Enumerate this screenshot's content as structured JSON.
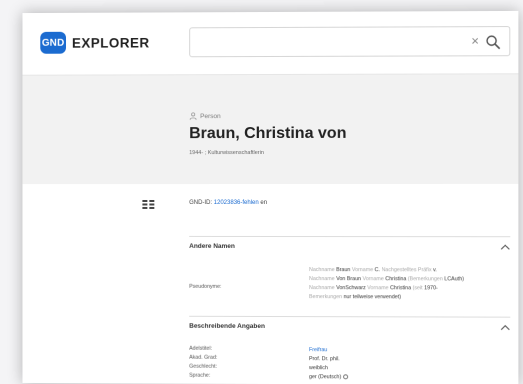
{
  "app": {
    "logo_badge": "GND",
    "logo_text": "EXPLORER",
    "brand_color": "#1b6bd0"
  },
  "search": {
    "value": "",
    "clear_glyph": "×",
    "search_icon": "search-icon"
  },
  "record": {
    "type": "Person",
    "title": "Braun, Christina von",
    "subtitle": "1944- ; Kulturwissenschaftlerin",
    "gnd_id_label": "GND-ID:",
    "gnd_id_value": "12023836-fehlen",
    "gnd_id_suffix": "en"
  },
  "sections": {
    "other_names": {
      "title": "Andere Namen",
      "pseudonyme_label": "Pseudonyme:",
      "line1": {
        "f1": "Nachname",
        "v1": "Braun",
        "f2": "Vorname",
        "v2": "C.",
        "f3": "Nachgestelltes Präfix",
        "v3": "v."
      },
      "line2": {
        "f1": "Nachname",
        "v1": "Von Braun",
        "f2": "Vorname",
        "v2": "Christina",
        "f3": "(Bemerkungen",
        "v3": "LCAuth)"
      },
      "line3": {
        "f1": "Nachname",
        "v1": "VonSchwarz",
        "f2": "Vorname",
        "v2": "Christina",
        "f3": "(seit",
        "v3": "1970-"
      },
      "line4": {
        "f1": "Bemerkungen",
        "v1": "nur teilweise verwendet)"
      }
    },
    "descriptive": {
      "title": "Beschreibende Angaben",
      "rows": [
        {
          "label": "Adelstitel:",
          "value": "Freifrau"
        },
        {
          "label": "Akad. Grad:",
          "value": "Prof. Dr. phil."
        },
        {
          "label": "Geschlecht:",
          "value": "weiblich"
        },
        {
          "label": "Sprache:",
          "value": "ger (Deutsch)"
        }
      ]
    }
  }
}
